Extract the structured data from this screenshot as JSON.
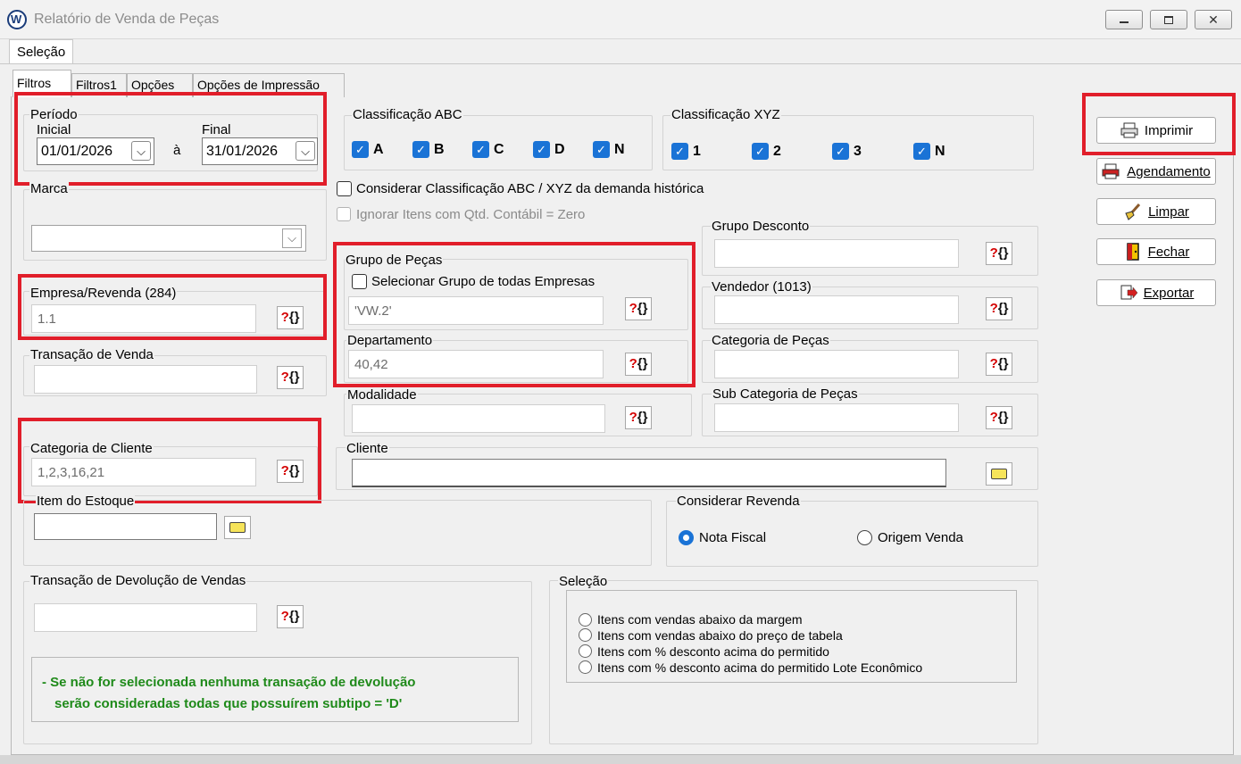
{
  "window": {
    "title": "Relatório de Venda de Peças"
  },
  "menu": {
    "selection_label": "Seleção"
  },
  "tabs": [
    {
      "label": "Filtros"
    },
    {
      "label": "Filtros1"
    },
    {
      "label": "Opções"
    },
    {
      "label": "Opções de Impressão"
    }
  ],
  "periodo": {
    "label": "Período",
    "inicial_label": "Inicial",
    "inicial_value": "01/01/2026",
    "separator": "à",
    "final_label": "Final",
    "final_value": "31/01/2026"
  },
  "marca": {
    "label": "Marca"
  },
  "empresa": {
    "label": "Empresa/Revenda (284)",
    "value": "1.1"
  },
  "transacao_venda": {
    "label": "Transação de Venda",
    "value": ""
  },
  "categoria_cliente": {
    "label": "Categoria de Cliente",
    "value": "1,2,3,16,21"
  },
  "item_estoque": {
    "label": "Item do Estoque",
    "value": ""
  },
  "transacao_devolucao": {
    "label": "Transação de Devolução de Vendas",
    "value": ""
  },
  "note": {
    "line1": "- Se não for selecionada nenhuma transação de devolução",
    "line2": "serão consideradas todas que possuírem subtipo = 'D'"
  },
  "classificacao_abc": {
    "label": "Classificação ABC",
    "items": [
      "A",
      "B",
      "C",
      "D",
      "N"
    ]
  },
  "classificacao_xyz": {
    "label": "Classificação XYZ",
    "items": [
      "1",
      "2",
      "3",
      "N"
    ]
  },
  "checkbox_historica": "Considerar Classificação ABC / XYZ da demanda histórica",
  "checkbox_ignorar": "Ignorar Itens com Qtd. Contábil = Zero",
  "grupo_pecas": {
    "label": "Grupo de Peças",
    "checkbox_label": "Selecionar Grupo de todas Empresas",
    "value": "'VW.2'"
  },
  "departamento": {
    "label": "Departamento",
    "value": "40,42"
  },
  "modalidade": {
    "label": "Modalidade",
    "value": ""
  },
  "cliente": {
    "label": "Cliente",
    "value": ""
  },
  "grupo_desconto": {
    "label": "Grupo Desconto",
    "value": ""
  },
  "vendedor": {
    "label": "Vendedor (1013)",
    "value": ""
  },
  "categoria_pecas": {
    "label": "Categoria de Peças",
    "value": ""
  },
  "sub_categoria_pecas": {
    "label": "Sub Categoria de Peças",
    "value": ""
  },
  "considerar_revenda": {
    "label": "Considerar Revenda",
    "option1": "Nota Fiscal",
    "option2": "Origem Venda"
  },
  "selecao": {
    "label": "Seleção",
    "options": [
      "Itens com vendas abaixo da margem",
      "Itens com vendas abaixo do preço de tabela",
      "Itens com % desconto acima do permitido",
      "Itens com % desconto acima do permitido Lote Econômico"
    ]
  },
  "buttons": {
    "imprimir": "Imprimir",
    "agendamento": "Agendamento",
    "limpar": "Limpar",
    "fechar": "Fechar",
    "exportar": "Exportar"
  },
  "lookup_glyph": {
    "q": "?",
    "b": "{}"
  },
  "colors": {
    "highlight": "#e11e2a",
    "accent": "#1a73d6",
    "note": "#1f8a1a"
  }
}
